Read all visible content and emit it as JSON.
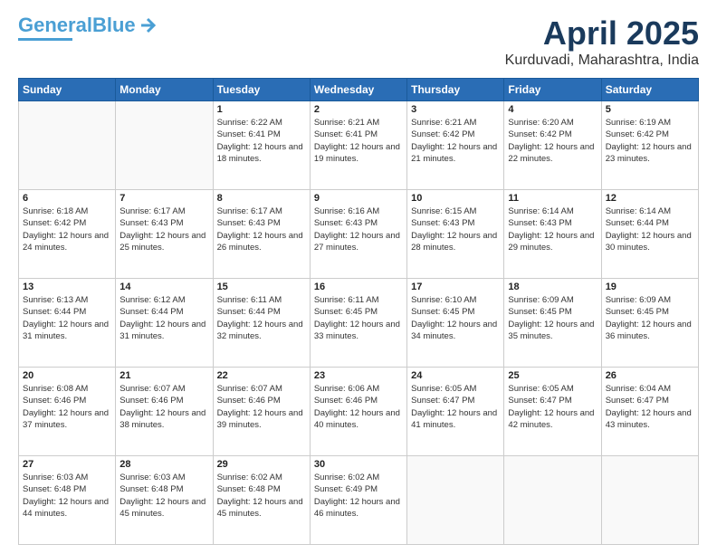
{
  "header": {
    "logo_line1": "General",
    "logo_line2": "Blue",
    "month": "April 2025",
    "location": "Kurduvadi, Maharashtra, India"
  },
  "days_of_week": [
    "Sunday",
    "Monday",
    "Tuesday",
    "Wednesday",
    "Thursday",
    "Friday",
    "Saturday"
  ],
  "weeks": [
    [
      {
        "day": "",
        "info": ""
      },
      {
        "day": "",
        "info": ""
      },
      {
        "day": "1",
        "info": "Sunrise: 6:22 AM\nSunset: 6:41 PM\nDaylight: 12 hours and 18 minutes."
      },
      {
        "day": "2",
        "info": "Sunrise: 6:21 AM\nSunset: 6:41 PM\nDaylight: 12 hours and 19 minutes."
      },
      {
        "day": "3",
        "info": "Sunrise: 6:21 AM\nSunset: 6:42 PM\nDaylight: 12 hours and 21 minutes."
      },
      {
        "day": "4",
        "info": "Sunrise: 6:20 AM\nSunset: 6:42 PM\nDaylight: 12 hours and 22 minutes."
      },
      {
        "day": "5",
        "info": "Sunrise: 6:19 AM\nSunset: 6:42 PM\nDaylight: 12 hours and 23 minutes."
      }
    ],
    [
      {
        "day": "6",
        "info": "Sunrise: 6:18 AM\nSunset: 6:42 PM\nDaylight: 12 hours and 24 minutes."
      },
      {
        "day": "7",
        "info": "Sunrise: 6:17 AM\nSunset: 6:43 PM\nDaylight: 12 hours and 25 minutes."
      },
      {
        "day": "8",
        "info": "Sunrise: 6:17 AM\nSunset: 6:43 PM\nDaylight: 12 hours and 26 minutes."
      },
      {
        "day": "9",
        "info": "Sunrise: 6:16 AM\nSunset: 6:43 PM\nDaylight: 12 hours and 27 minutes."
      },
      {
        "day": "10",
        "info": "Sunrise: 6:15 AM\nSunset: 6:43 PM\nDaylight: 12 hours and 28 minutes."
      },
      {
        "day": "11",
        "info": "Sunrise: 6:14 AM\nSunset: 6:43 PM\nDaylight: 12 hours and 29 minutes."
      },
      {
        "day": "12",
        "info": "Sunrise: 6:14 AM\nSunset: 6:44 PM\nDaylight: 12 hours and 30 minutes."
      }
    ],
    [
      {
        "day": "13",
        "info": "Sunrise: 6:13 AM\nSunset: 6:44 PM\nDaylight: 12 hours and 31 minutes."
      },
      {
        "day": "14",
        "info": "Sunrise: 6:12 AM\nSunset: 6:44 PM\nDaylight: 12 hours and 31 minutes."
      },
      {
        "day": "15",
        "info": "Sunrise: 6:11 AM\nSunset: 6:44 PM\nDaylight: 12 hours and 32 minutes."
      },
      {
        "day": "16",
        "info": "Sunrise: 6:11 AM\nSunset: 6:45 PM\nDaylight: 12 hours and 33 minutes."
      },
      {
        "day": "17",
        "info": "Sunrise: 6:10 AM\nSunset: 6:45 PM\nDaylight: 12 hours and 34 minutes."
      },
      {
        "day": "18",
        "info": "Sunrise: 6:09 AM\nSunset: 6:45 PM\nDaylight: 12 hours and 35 minutes."
      },
      {
        "day": "19",
        "info": "Sunrise: 6:09 AM\nSunset: 6:45 PM\nDaylight: 12 hours and 36 minutes."
      }
    ],
    [
      {
        "day": "20",
        "info": "Sunrise: 6:08 AM\nSunset: 6:46 PM\nDaylight: 12 hours and 37 minutes."
      },
      {
        "day": "21",
        "info": "Sunrise: 6:07 AM\nSunset: 6:46 PM\nDaylight: 12 hours and 38 minutes."
      },
      {
        "day": "22",
        "info": "Sunrise: 6:07 AM\nSunset: 6:46 PM\nDaylight: 12 hours and 39 minutes."
      },
      {
        "day": "23",
        "info": "Sunrise: 6:06 AM\nSunset: 6:46 PM\nDaylight: 12 hours and 40 minutes."
      },
      {
        "day": "24",
        "info": "Sunrise: 6:05 AM\nSunset: 6:47 PM\nDaylight: 12 hours and 41 minutes."
      },
      {
        "day": "25",
        "info": "Sunrise: 6:05 AM\nSunset: 6:47 PM\nDaylight: 12 hours and 42 minutes."
      },
      {
        "day": "26",
        "info": "Sunrise: 6:04 AM\nSunset: 6:47 PM\nDaylight: 12 hours and 43 minutes."
      }
    ],
    [
      {
        "day": "27",
        "info": "Sunrise: 6:03 AM\nSunset: 6:48 PM\nDaylight: 12 hours and 44 minutes."
      },
      {
        "day": "28",
        "info": "Sunrise: 6:03 AM\nSunset: 6:48 PM\nDaylight: 12 hours and 45 minutes."
      },
      {
        "day": "29",
        "info": "Sunrise: 6:02 AM\nSunset: 6:48 PM\nDaylight: 12 hours and 45 minutes."
      },
      {
        "day": "30",
        "info": "Sunrise: 6:02 AM\nSunset: 6:49 PM\nDaylight: 12 hours and 46 minutes."
      },
      {
        "day": "",
        "info": ""
      },
      {
        "day": "",
        "info": ""
      },
      {
        "day": "",
        "info": ""
      }
    ]
  ]
}
